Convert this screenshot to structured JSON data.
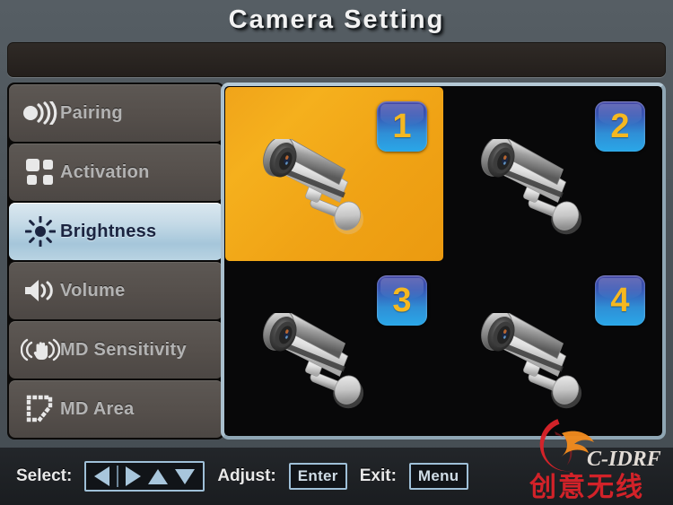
{
  "header": {
    "title": "Camera Setting",
    "status_text": ""
  },
  "sidebar": {
    "items": [
      {
        "id": "pairing",
        "label": "Pairing",
        "icon": "signal-wave-icon",
        "selected": false
      },
      {
        "id": "activation",
        "label": "Activation",
        "icon": "grid-squares-icon",
        "selected": false
      },
      {
        "id": "brightness",
        "label": "Brightness",
        "icon": "sun-icon",
        "selected": true
      },
      {
        "id": "volume",
        "label": "Volume",
        "icon": "speaker-icon",
        "selected": false
      },
      {
        "id": "md-sensitivity",
        "label": "MD Sensitivity",
        "icon": "hand-motion-icon",
        "selected": false
      },
      {
        "id": "md-area",
        "label": "MD Area",
        "icon": "dotted-region-icon",
        "selected": false
      }
    ]
  },
  "camera_grid": {
    "cameras": [
      {
        "number": "1",
        "selected": true
      },
      {
        "number": "2",
        "selected": false
      },
      {
        "number": "3",
        "selected": false
      },
      {
        "number": "4",
        "selected": false
      }
    ]
  },
  "footer": {
    "select_label": "Select:",
    "arrows": [
      "left-arrow",
      "right-arrow",
      "up-arrow",
      "down-arrow"
    ],
    "adjust_label": "Adjust:",
    "adjust_key": "Enter",
    "exit_label": "Exit:",
    "exit_key": "Menu"
  },
  "watermark": {
    "brand_latin": "C-IDRF",
    "brand_cjk": "创意无线"
  },
  "colors": {
    "background": "#4b5359",
    "selected_menu": "#bad6e6",
    "selected_camera": "#f0a41a",
    "badge_number": "#f5b820",
    "key_border": "#9fc0d8",
    "panel_border": "#a9bfcd",
    "watermark_red": "#d8232a",
    "watermark_orange": "#f08a1e"
  }
}
